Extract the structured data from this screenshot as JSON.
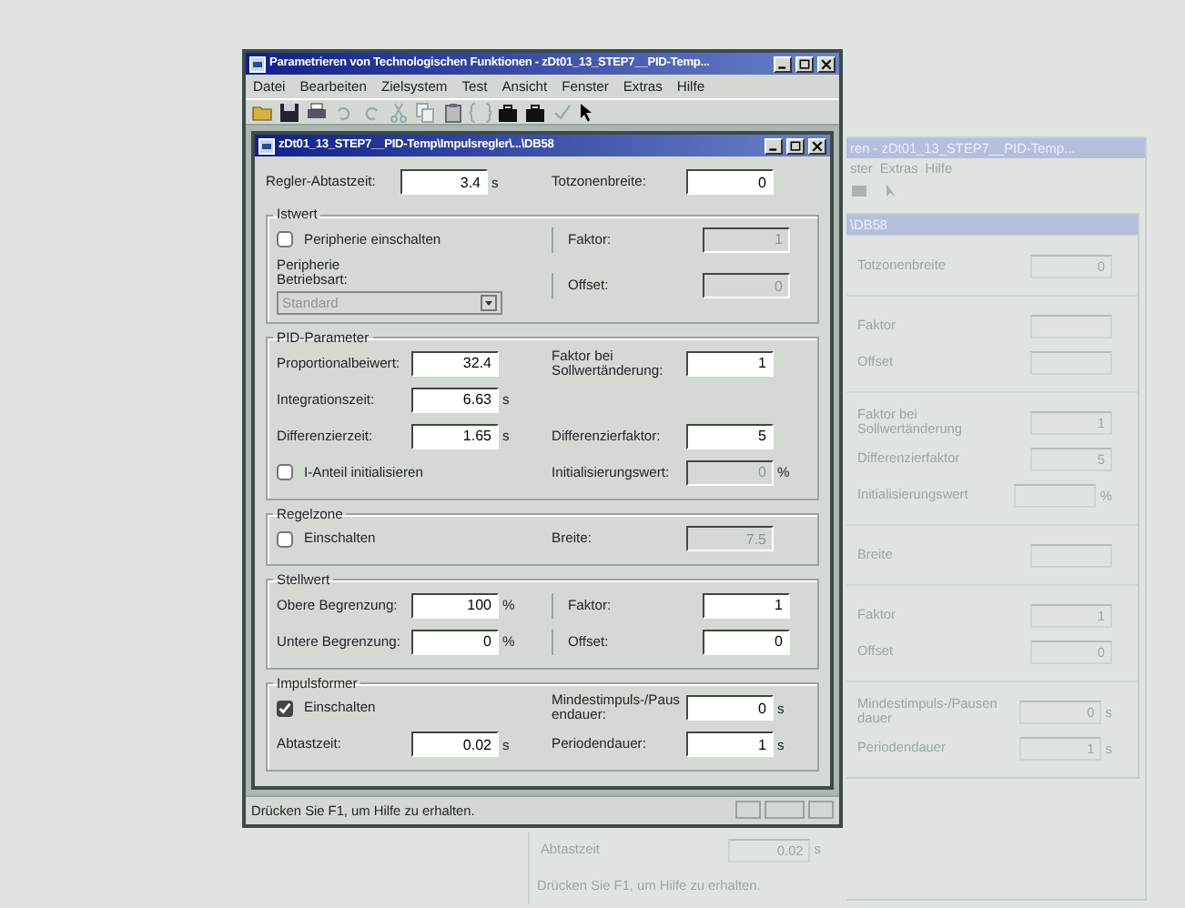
{
  "window": {
    "title": "Parametrieren von Technologischen Funktionen - zDt01_13_STEP7__PID-Temp...",
    "menu": [
      "Datei",
      "Bearbeiten",
      "Zielsystem",
      "Test",
      "Ansicht",
      "Fenster",
      "Extras",
      "Hilfe"
    ]
  },
  "dialog": {
    "title": "zDt01_13_STEP7__PID-Temp\\Impulsregler\\...\\DB58",
    "top_row": {
      "left": {
        "label": "Regler-Abtastzeit:",
        "value": "3.4",
        "unit": "s",
        "disabled": false
      },
      "right": {
        "label": "Totzonenbreite:",
        "value": "0",
        "disabled": false
      }
    },
    "groups": [
      {
        "title": "Istwert",
        "divided": true,
        "rows": [
          {
            "left": {
              "kind": "checkbox",
              "label": "Peripherie einschalten",
              "checked": false
            },
            "right": {
              "label": "Faktor:",
              "value": "1",
              "disabled": true
            }
          },
          {
            "left": {
              "kind": "select",
              "label": "Peripherie Betriebsart:",
              "value": "Standard",
              "disabled": true
            },
            "right": {
              "label": "Offset:",
              "value": "0",
              "disabled": true
            }
          }
        ]
      },
      {
        "title": "PID-Parameter",
        "divided": false,
        "rows": [
          {
            "left": {
              "label": "Proportionalbeiwert:",
              "value": "32.4",
              "disabled": false
            },
            "right": {
              "label": "Faktor bei Sollwertänderung:",
              "value": "1",
              "disabled": false
            }
          },
          {
            "left": {
              "label": "Integrationszeit:",
              "value": "6.63",
              "unit": "s",
              "disabled": false
            }
          },
          {
            "left": {
              "label": "Differenzierzeit:",
              "value": "1.65",
              "unit": "s",
              "disabled": false
            },
            "right": {
              "label": "Differenzierfaktor:",
              "value": "5",
              "disabled": false
            }
          },
          {
            "left": {
              "kind": "checkbox",
              "label": "I-Anteil initialisieren",
              "checked": false
            },
            "right": {
              "label": "Initialisierungswert:",
              "value": "0",
              "unit": "%",
              "disabled": true
            }
          }
        ]
      },
      {
        "title": "Regelzone",
        "divided": false,
        "rows": [
          {
            "left": {
              "kind": "checkbox",
              "label": "Einschalten",
              "checked": false
            },
            "right": {
              "label": "Breite:",
              "value": "7.5",
              "disabled": true
            }
          }
        ]
      },
      {
        "title": "Stellwert",
        "divided": true,
        "rows": [
          {
            "left": {
              "label": "Obere Begrenzung:",
              "value": "100",
              "unit": "%",
              "disabled": false
            },
            "right": {
              "label": "Faktor:",
              "value": "1",
              "disabled": false
            }
          },
          {
            "left": {
              "label": "Untere Begrenzung:",
              "value": "0",
              "unit": "%",
              "disabled": false
            },
            "right": {
              "label": "Offset:",
              "value": "0",
              "disabled": false
            }
          }
        ]
      },
      {
        "title": "Impulsformer",
        "divided": false,
        "rows": [
          {
            "left": {
              "kind": "checkbox",
              "label": "Einschalten",
              "checked": true
            },
            "right": {
              "label": "Mindestimpuls-/Pausendauer:",
              "value": "0",
              "unit": "s",
              "disabled": false
            }
          },
          {
            "left": {
              "label": "Abtastzeit:",
              "value": "0.02",
              "unit": "s",
              "disabled": false
            },
            "right": {
              "label": "Periodendauer:",
              "value": "1",
              "unit": "s",
              "disabled": false
            }
          }
        ]
      }
    ]
  },
  "status_bar": "Drücken Sie F1, um Hilfe zu erhalten.",
  "ghost_window": {
    "title": "ren - zDt01_13_STEP7__PID-Temp...",
    "menu": [
      "ster",
      "Extras",
      "Hilfe"
    ],
    "dialog_title": "\\DB58",
    "groups": [
      [
        {
          "label": "Totzonenbreite",
          "value": "0"
        }
      ],
      [
        {
          "label": "Faktor"
        },
        {
          "label": "Offset"
        }
      ],
      [
        {
          "label": "Faktor bei Sollwertänderung",
          "value": "1"
        },
        {
          "label": "Differenzierfaktor",
          "value": "5"
        },
        {
          "label": "Initialisierungswert",
          "unit": "%"
        }
      ],
      [
        {
          "label": "Breite"
        }
      ],
      [
        {
          "label": "Faktor",
          "value": "1"
        },
        {
          "label": "Offset",
          "value": "0"
        }
      ],
      [
        {
          "label": "Mindestimpuls-/Pausendauer",
          "value": "0",
          "unit": "s"
        },
        {
          "label": "Periodendauer",
          "value": "1",
          "unit": "s"
        }
      ]
    ],
    "bottom_field": {
      "label": "Abtastzeit",
      "value": "0.02",
      "unit": "s"
    },
    "status_bar": "Drücken Sie F1, um Hilfe zu erhalten."
  }
}
